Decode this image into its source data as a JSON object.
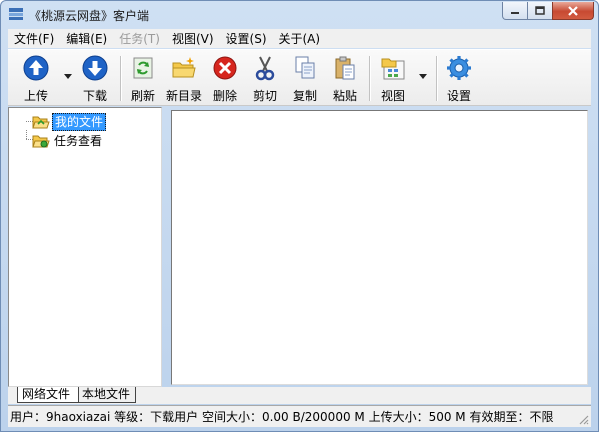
{
  "window": {
    "title": "《桃源云网盘》客户端"
  },
  "menu": {
    "items": [
      {
        "label": "文件(F)",
        "enabled": true
      },
      {
        "label": "编辑(E)",
        "enabled": true
      },
      {
        "label": "任务(T)",
        "enabled": false
      },
      {
        "label": "视图(V)",
        "enabled": true
      },
      {
        "label": "设置(S)",
        "enabled": true
      },
      {
        "label": "关于(A)",
        "enabled": true
      }
    ]
  },
  "toolbar": {
    "upload": "上传",
    "download": "下载",
    "refresh": "刷新",
    "new_folder": "新目录",
    "delete": "删除",
    "cut": "剪切",
    "copy": "复制",
    "paste": "粘贴",
    "view": "视图",
    "settings": "设置"
  },
  "tree": {
    "items": [
      {
        "label": "我的文件",
        "icon": "folder-open-icon",
        "selected": true
      },
      {
        "label": "任务查看",
        "icon": "task-folder-icon",
        "selected": false
      }
    ]
  },
  "tabs": {
    "items": [
      {
        "label": "网络文件",
        "active": true
      },
      {
        "label": "本地文件",
        "active": false
      }
    ]
  },
  "status": {
    "text": "用户：9haoxiazai  等级：下载用户  空间大小：0.00 B/200000 M  上传大小：500 M  有效期至：不限"
  },
  "colors": {
    "selection": "#3399ff",
    "title_bar": "#c6daf1",
    "close_button": "#c74a32"
  }
}
